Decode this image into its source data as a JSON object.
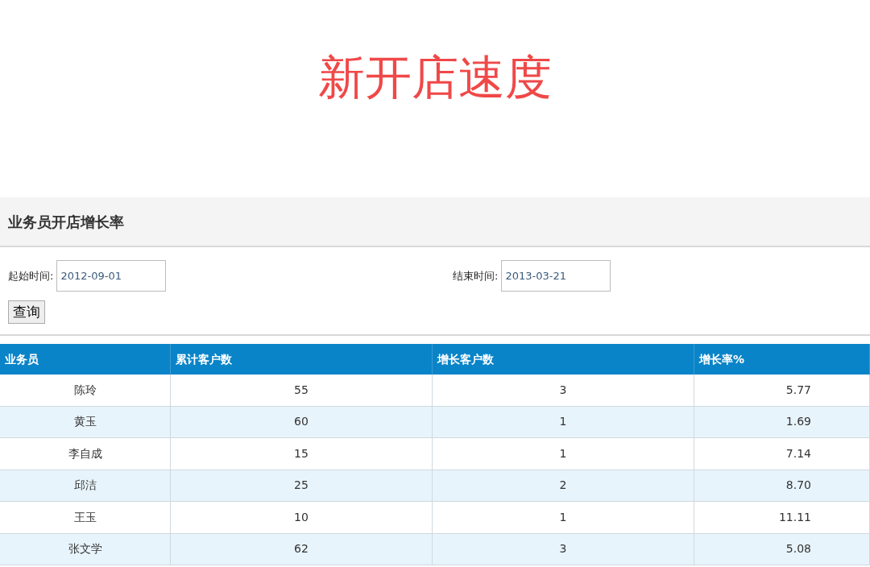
{
  "title": "新开店速度",
  "panel": {
    "heading": "业务员开店增长率",
    "filters": [
      {
        "label": "起始时间:",
        "value": "2012-09-01"
      },
      {
        "label": "结束时间:",
        "value": "2013-03-21"
      }
    ],
    "button": "查询"
  },
  "table": {
    "columns": [
      "业务员",
      "累计客户数",
      "增长客户数",
      "增长率%"
    ],
    "rows": [
      [
        "陈玲",
        "55",
        "3",
        "5.77"
      ],
      [
        "黄玉",
        "60",
        "1",
        "1.69"
      ],
      [
        "李自成",
        "15",
        "1",
        "7.14"
      ],
      [
        "邱洁",
        "25",
        "2",
        "8.70"
      ],
      [
        "王玉",
        "10",
        "1",
        "11.11"
      ],
      [
        "张文学",
        "62",
        "3",
        "5.08"
      ]
    ]
  }
}
